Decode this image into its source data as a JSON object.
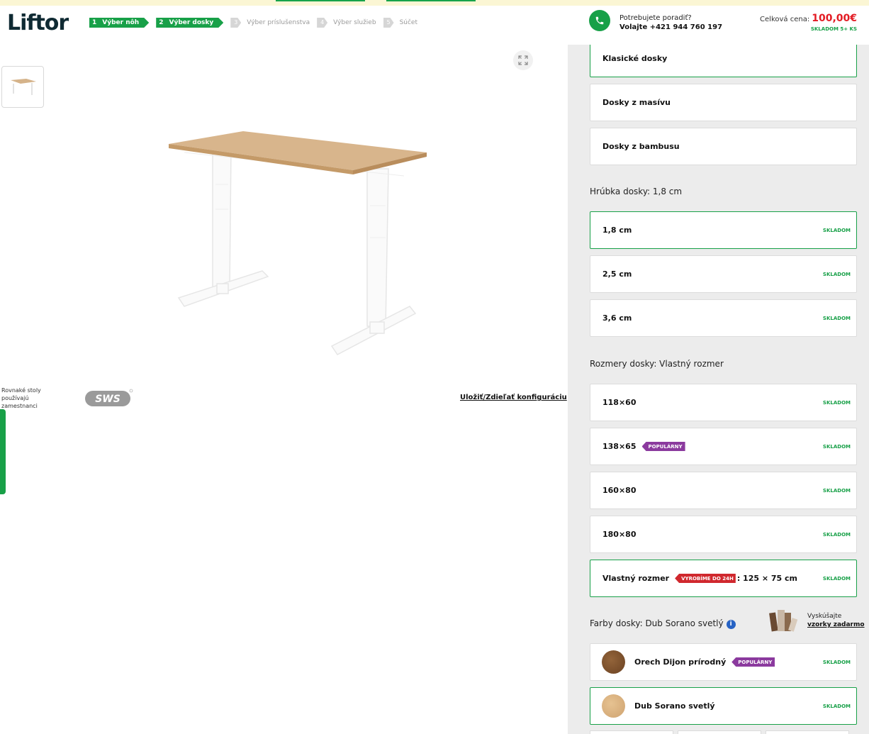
{
  "header": {
    "logo": "Liftor",
    "steps": [
      {
        "num": "1",
        "label": "Výber nôh",
        "state": "done"
      },
      {
        "num": "2",
        "label": "Výber dosky",
        "state": "done"
      },
      {
        "num": "3",
        "label": "Výber príslušenstva",
        "state": "todo"
      },
      {
        "num": "4",
        "label": "Výber služieb",
        "state": "todo"
      },
      {
        "num": "5",
        "label": "Súčet",
        "state": "todo"
      }
    ],
    "help_question": "Potrebujete poradiť?",
    "help_phone": "Volajte +421 944 760 197",
    "price_label": "Celková cena:",
    "price_value": "100,00€",
    "price_stock": "SKLADOM 5+ KS"
  },
  "left": {
    "brand_note": "Rovnaké stoly používajú zamestnanci",
    "save_link": "Uložiť/Zdieľať konfiguráciu"
  },
  "panel": {
    "board_types": [
      {
        "label": "Klasické dosky",
        "selected": true
      },
      {
        "label": "Dosky z masívu",
        "selected": false
      },
      {
        "label": "Dosky z bambusu",
        "selected": false
      }
    ],
    "thickness_title": "Hrúbka dosky: 1,8 cm",
    "thickness": [
      {
        "label": "1,8 cm",
        "stock": "SKLADOM",
        "selected": true
      },
      {
        "label": "2,5 cm",
        "stock": "SKLADOM",
        "selected": false
      },
      {
        "label": "3,6 cm",
        "stock": "SKLADOM",
        "selected": false
      }
    ],
    "size_title": "Rozmery dosky: Vlastný rozmer",
    "sizes": [
      {
        "label": "118×60",
        "stock": "SKLADOM"
      },
      {
        "label": "138×65",
        "stock": "SKLADOM",
        "tag": "POPULÁRNY"
      },
      {
        "label": "160×80",
        "stock": "SKLADOM"
      },
      {
        "label": "180×80",
        "stock": "SKLADOM"
      },
      {
        "label": "Vlastný rozmer",
        "stock": "SKLADOM",
        "tag": "VYROBÍME DO 24H",
        "extra": ": 125 × 75 cm",
        "selected": true
      }
    ],
    "color_title": "Farby dosky: Dub Sorano svetlý",
    "samples_text": "Vyskúšajte",
    "samples_link": "vzorky zadarmo",
    "colors": [
      {
        "label": "Orech Dijon prírodný",
        "stock": "SKLADOM",
        "tag": "POPULÁRNY",
        "swatch": "#7a4f2a"
      },
      {
        "label": "Dub Sorano svetlý",
        "stock": "SKLADOM",
        "selected": true,
        "swatch": "#dcb27c"
      }
    ]
  },
  "colors": {
    "accent": "#18a048",
    "price": "#e31b23",
    "popular": "#8b3a9e",
    "express": "#d0282e"
  }
}
